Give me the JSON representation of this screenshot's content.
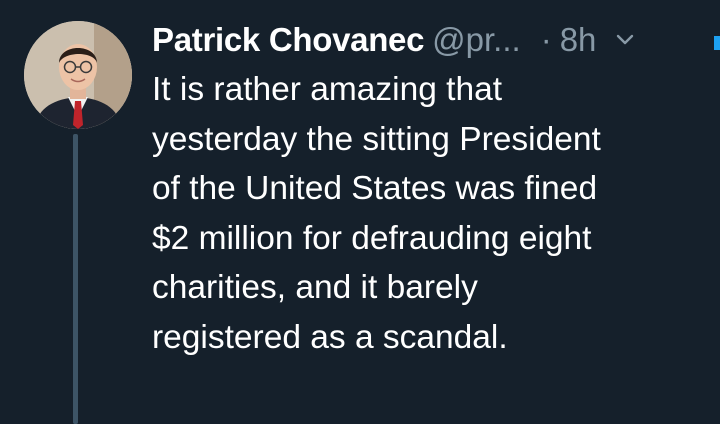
{
  "tweet": {
    "author_name": "Patrick Chovanec",
    "author_handle": "@pr...",
    "separator": "·",
    "time": "8h",
    "text": "It is rather amazing that\nyesterday the sitting President\nof the United States was fined\n$2 million for defrauding eight\ncharities, and it barely\nregistered as a scandal."
  },
  "icons": {
    "avatar": "profile-photo",
    "menu": "chevron-down-icon"
  },
  "colors": {
    "background": "#15202b",
    "text": "#ffffff",
    "muted": "#8899a6",
    "thread_line": "#3d5466",
    "accent": "#1da1f2"
  }
}
